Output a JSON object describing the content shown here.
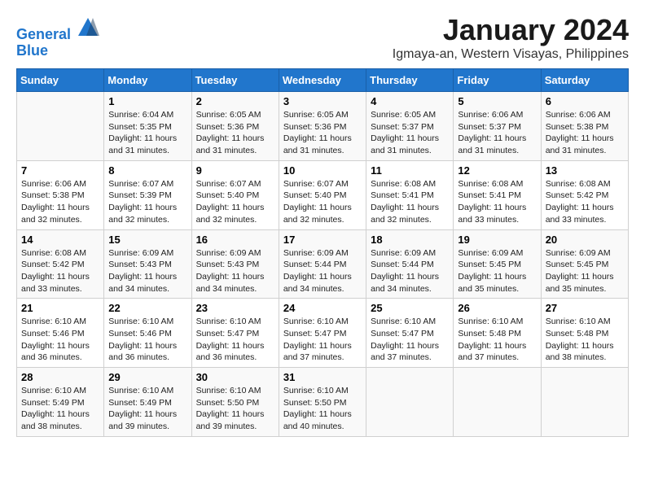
{
  "header": {
    "logo_line1": "General",
    "logo_line2": "Blue",
    "month": "January 2024",
    "location": "Igmaya-an, Western Visayas, Philippines"
  },
  "days_of_week": [
    "Sunday",
    "Monday",
    "Tuesday",
    "Wednesday",
    "Thursday",
    "Friday",
    "Saturday"
  ],
  "weeks": [
    [
      {
        "day": "",
        "info": ""
      },
      {
        "day": "1",
        "info": "Sunrise: 6:04 AM\nSunset: 5:35 PM\nDaylight: 11 hours\nand 31 minutes."
      },
      {
        "day": "2",
        "info": "Sunrise: 6:05 AM\nSunset: 5:36 PM\nDaylight: 11 hours\nand 31 minutes."
      },
      {
        "day": "3",
        "info": "Sunrise: 6:05 AM\nSunset: 5:36 PM\nDaylight: 11 hours\nand 31 minutes."
      },
      {
        "day": "4",
        "info": "Sunrise: 6:05 AM\nSunset: 5:37 PM\nDaylight: 11 hours\nand 31 minutes."
      },
      {
        "day": "5",
        "info": "Sunrise: 6:06 AM\nSunset: 5:37 PM\nDaylight: 11 hours\nand 31 minutes."
      },
      {
        "day": "6",
        "info": "Sunrise: 6:06 AM\nSunset: 5:38 PM\nDaylight: 11 hours\nand 31 minutes."
      }
    ],
    [
      {
        "day": "7",
        "info": "Sunrise: 6:06 AM\nSunset: 5:38 PM\nDaylight: 11 hours\nand 32 minutes."
      },
      {
        "day": "8",
        "info": "Sunrise: 6:07 AM\nSunset: 5:39 PM\nDaylight: 11 hours\nand 32 minutes."
      },
      {
        "day": "9",
        "info": "Sunrise: 6:07 AM\nSunset: 5:40 PM\nDaylight: 11 hours\nand 32 minutes."
      },
      {
        "day": "10",
        "info": "Sunrise: 6:07 AM\nSunset: 5:40 PM\nDaylight: 11 hours\nand 32 minutes."
      },
      {
        "day": "11",
        "info": "Sunrise: 6:08 AM\nSunset: 5:41 PM\nDaylight: 11 hours\nand 32 minutes."
      },
      {
        "day": "12",
        "info": "Sunrise: 6:08 AM\nSunset: 5:41 PM\nDaylight: 11 hours\nand 33 minutes."
      },
      {
        "day": "13",
        "info": "Sunrise: 6:08 AM\nSunset: 5:42 PM\nDaylight: 11 hours\nand 33 minutes."
      }
    ],
    [
      {
        "day": "14",
        "info": "Sunrise: 6:08 AM\nSunset: 5:42 PM\nDaylight: 11 hours\nand 33 minutes."
      },
      {
        "day": "15",
        "info": "Sunrise: 6:09 AM\nSunset: 5:43 PM\nDaylight: 11 hours\nand 34 minutes."
      },
      {
        "day": "16",
        "info": "Sunrise: 6:09 AM\nSunset: 5:43 PM\nDaylight: 11 hours\nand 34 minutes."
      },
      {
        "day": "17",
        "info": "Sunrise: 6:09 AM\nSunset: 5:44 PM\nDaylight: 11 hours\nand 34 minutes."
      },
      {
        "day": "18",
        "info": "Sunrise: 6:09 AM\nSunset: 5:44 PM\nDaylight: 11 hours\nand 34 minutes."
      },
      {
        "day": "19",
        "info": "Sunrise: 6:09 AM\nSunset: 5:45 PM\nDaylight: 11 hours\nand 35 minutes."
      },
      {
        "day": "20",
        "info": "Sunrise: 6:09 AM\nSunset: 5:45 PM\nDaylight: 11 hours\nand 35 minutes."
      }
    ],
    [
      {
        "day": "21",
        "info": "Sunrise: 6:10 AM\nSunset: 5:46 PM\nDaylight: 11 hours\nand 36 minutes."
      },
      {
        "day": "22",
        "info": "Sunrise: 6:10 AM\nSunset: 5:46 PM\nDaylight: 11 hours\nand 36 minutes."
      },
      {
        "day": "23",
        "info": "Sunrise: 6:10 AM\nSunset: 5:47 PM\nDaylight: 11 hours\nand 36 minutes."
      },
      {
        "day": "24",
        "info": "Sunrise: 6:10 AM\nSunset: 5:47 PM\nDaylight: 11 hours\nand 37 minutes."
      },
      {
        "day": "25",
        "info": "Sunrise: 6:10 AM\nSunset: 5:47 PM\nDaylight: 11 hours\nand 37 minutes."
      },
      {
        "day": "26",
        "info": "Sunrise: 6:10 AM\nSunset: 5:48 PM\nDaylight: 11 hours\nand 37 minutes."
      },
      {
        "day": "27",
        "info": "Sunrise: 6:10 AM\nSunset: 5:48 PM\nDaylight: 11 hours\nand 38 minutes."
      }
    ],
    [
      {
        "day": "28",
        "info": "Sunrise: 6:10 AM\nSunset: 5:49 PM\nDaylight: 11 hours\nand 38 minutes."
      },
      {
        "day": "29",
        "info": "Sunrise: 6:10 AM\nSunset: 5:49 PM\nDaylight: 11 hours\nand 39 minutes."
      },
      {
        "day": "30",
        "info": "Sunrise: 6:10 AM\nSunset: 5:50 PM\nDaylight: 11 hours\nand 39 minutes."
      },
      {
        "day": "31",
        "info": "Sunrise: 6:10 AM\nSunset: 5:50 PM\nDaylight: 11 hours\nand 40 minutes."
      },
      {
        "day": "",
        "info": ""
      },
      {
        "day": "",
        "info": ""
      },
      {
        "day": "",
        "info": ""
      }
    ]
  ]
}
